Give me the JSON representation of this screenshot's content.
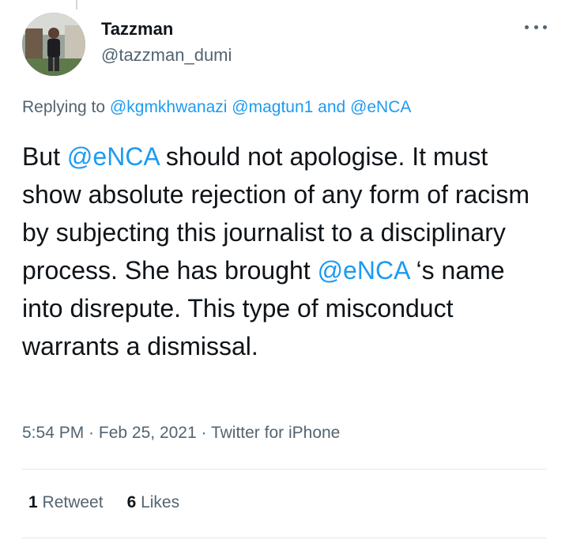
{
  "tweet": {
    "author": {
      "display_name": "Tazzman",
      "handle": "@tazzman_dumi"
    },
    "replying": {
      "prefix": "Replying to ",
      "mentions": [
        "@kgmkhwanazi",
        "@magtun1"
      ],
      "and_word": " and ",
      "last_mention": "@eNCA"
    },
    "text_parts": {
      "p1": "But ",
      "m1": "@eNCA",
      "p2": " should not apologise. It must show absolute rejection of any form of racism by subjecting this journalist to a disciplinary process. She has brought ",
      "m2": "@eNCA",
      "p3": " ‘s name into disrepute. This type of misconduct warrants a dismissal."
    },
    "meta": {
      "time": "5:54 PM",
      "sep": " · ",
      "date": "Feb 25, 2021",
      "source": "Twitter for iPhone"
    },
    "stats": {
      "retweets_count": "1",
      "retweets_label": " Retweet",
      "likes_count": "6",
      "likes_label": " Likes"
    }
  },
  "icons": {
    "more": "more-horizontal-icon"
  },
  "colors": {
    "link": "#1d9bf0",
    "secondary_text": "#536471",
    "primary_text": "#0f1419"
  }
}
